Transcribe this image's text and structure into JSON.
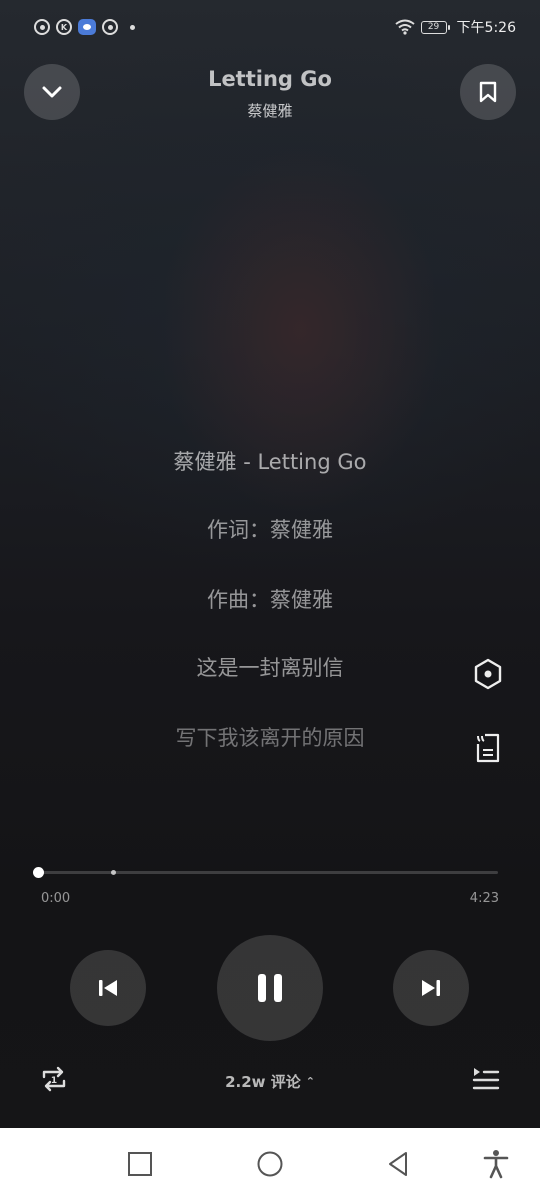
{
  "status_bar": {
    "battery_level": "29",
    "time": "下午5:26",
    "notification_icons": [
      "record-icon",
      "k-icon",
      "eye-app-icon",
      "record-icon",
      "dot-icon"
    ]
  },
  "header": {
    "title": "Letting Go",
    "artist": "蔡健雅"
  },
  "lyrics": {
    "lines": [
      "蔡健雅 - Letting Go",
      "作词：蔡健雅",
      "作曲：蔡健雅",
      "这是一封离别信",
      "写下我该离开的原因"
    ]
  },
  "player": {
    "current_time": "0:00",
    "total_time": "4:23",
    "progress": 0.0,
    "comments_label": "2.2w 评论",
    "comments_chevron": "⌃"
  },
  "colors": {
    "background": "#161619",
    "navbar": "#ffffff",
    "accent": "#ffffff"
  }
}
